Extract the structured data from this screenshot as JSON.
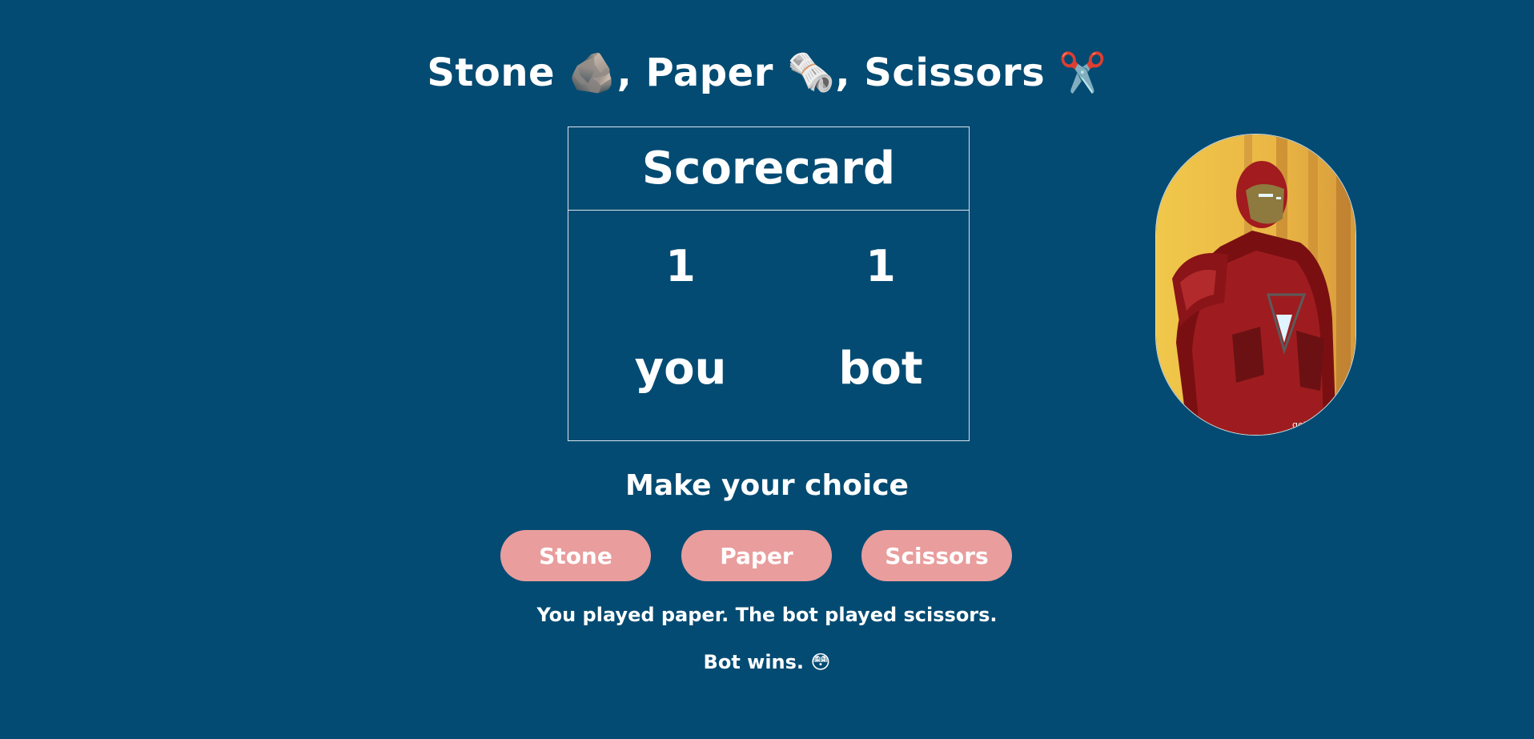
{
  "header": {
    "title_stone": "Stone",
    "title_paper": ", Paper",
    "title_scissors": ", Scissors",
    "stone_emoji": "🪨",
    "paper_emoji": "🗞️",
    "scissors_emoji": "✂️"
  },
  "scorecard": {
    "title": "Scorecard",
    "you_score": "1",
    "bot_score": "1",
    "you_label": "you",
    "bot_label": "bot"
  },
  "avatar": {
    "icon": "iron-man-image",
    "watermark": "getM"
  },
  "game": {
    "prompt": "Make your choice",
    "buttons": {
      "stone": "Stone",
      "paper": "Paper",
      "scissors": "Scissors"
    },
    "result_message": "You played paper. The bot played scissors.",
    "outcome": "Bot wins.",
    "outcome_emoji": "😳"
  },
  "colors": {
    "background": "#034b72",
    "button": "#e99d9d",
    "text": "#ffffff"
  }
}
